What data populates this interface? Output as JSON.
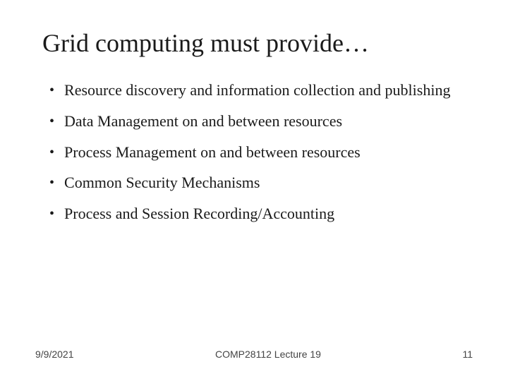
{
  "slide": {
    "title": "Grid computing must provide…",
    "bullets": [
      {
        "text": "Resource discovery and information collection and publishing"
      },
      {
        "text": "Data Management on and between resources"
      },
      {
        "text": "Process Management on and between resources"
      },
      {
        "text": "Common Security Mechanisms"
      },
      {
        "text": "Process and Session Recording/Accounting"
      }
    ],
    "footer": {
      "date": "9/9/2021",
      "course": "COMP28112 Lecture 19",
      "page": "11"
    }
  }
}
